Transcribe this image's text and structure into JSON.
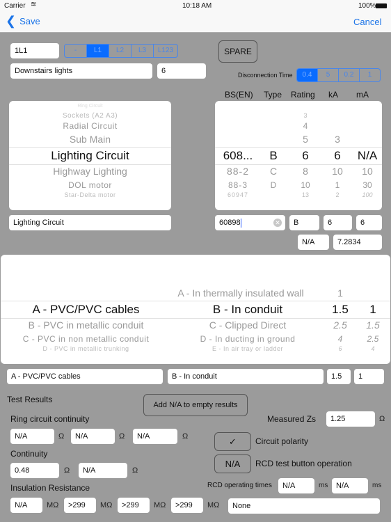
{
  "status_bar": {
    "carrier": "Carrier",
    "time": "10:18 AM",
    "battery": "100%"
  },
  "nav": {
    "save_label": "Save",
    "cancel_label": "Cancel"
  },
  "circuit": {
    "ref": "1L1",
    "phase_options": [
      "-",
      "L1",
      "L2",
      "L3",
      "L123"
    ],
    "phase_selected": "L1",
    "spare_label": "SPARE",
    "description": "Downstairs lights",
    "points": "6",
    "disconnection_label": "Disconnection Time",
    "disconnection_options": [
      "0.4",
      "5",
      "0.2",
      "1"
    ],
    "disconnection_selected": "0.4"
  },
  "protective_headers": [
    "BS(EN)",
    "Type",
    "Rating",
    "kA",
    "mA"
  ],
  "circuit_type_picker": {
    "above": [
      "Ring Circuit",
      "Sockets (A2 A3)",
      "Radial Circuit",
      "Sub Main"
    ],
    "selected": "Lighting Circuit",
    "below": [
      "Highway Lighting",
      "DOL motor",
      "Star-Delta motor"
    ]
  },
  "device_picker": {
    "bs": {
      "above": [],
      "selected": "608...",
      "below": [
        "88-2",
        "88-3",
        "60947"
      ]
    },
    "type": {
      "above": [],
      "selected": "B",
      "below": [
        "C",
        "D"
      ]
    },
    "rating": {
      "above": [
        "3",
        "4",
        "5"
      ],
      "selected": "6",
      "below": [
        "8",
        "10",
        "13"
      ]
    },
    "ka": {
      "above": [
        "3"
      ],
      "selected": "6",
      "below": [
        "10",
        "1",
        "2"
      ]
    },
    "ma": {
      "above": [],
      "selected": "N/A",
      "below": [
        "10",
        "30",
        "100"
      ]
    }
  },
  "device_fields": {
    "circuit_type": "Lighting Circuit",
    "bs": "60898",
    "type": "B",
    "rating": "6",
    "ka": "6",
    "ma": "N/A",
    "max_zs": "7.2834"
  },
  "cable_picker": {
    "cable": {
      "above": [],
      "selected": "A - PVC/PVC cables",
      "below": [
        "B - PVC in metallic conduit",
        "C - PVC in non metallic conduit",
        "D - PVC in metallic trunking"
      ]
    },
    "method": {
      "above": [
        "A - In thermally insulated wall"
      ],
      "selected": "B - In conduit",
      "below": [
        "C - Clipped Direct",
        "D - In ducting in ground",
        "E - In air tray or ladder"
      ]
    },
    "live": {
      "above": [
        "1"
      ],
      "selected": "1.5",
      "below": [
        "2.5",
        "4",
        "6"
      ]
    },
    "cpc": {
      "above": [],
      "selected": "1",
      "below": [
        "1.5",
        "2.5",
        "4"
      ]
    }
  },
  "cable_fields": {
    "cable": "A - PVC/PVC cables",
    "method": "B - In conduit",
    "live": "1.5",
    "cpc": "1"
  },
  "test_results": {
    "title": "Test Results",
    "add_na_label": "Add N/A to empty results",
    "ring_label": "Ring circuit continuity",
    "ring_values": [
      "N/A",
      "N/A",
      "N/A"
    ],
    "continuity_label": "Continuity",
    "continuity_values": [
      "0.48",
      "N/A"
    ],
    "insulation_label": "Insulation Resistance",
    "insulation_values": [
      "N/A",
      ">299",
      ">299",
      ">299"
    ],
    "zs_label": "Measured Zs",
    "zs_value": "1.25",
    "polarity_value": "✓",
    "polarity_label": "Circuit polarity",
    "rcd_button_value": "N/A",
    "rcd_button_label": "RCD test button operation",
    "rcd_times_label": "RCD operating times",
    "rcd_times": [
      "N/A",
      "N/A"
    ],
    "remarks": "None",
    "unit_ohm": "Ω",
    "unit_megaohm": "MΩ",
    "unit_ms": "ms"
  }
}
